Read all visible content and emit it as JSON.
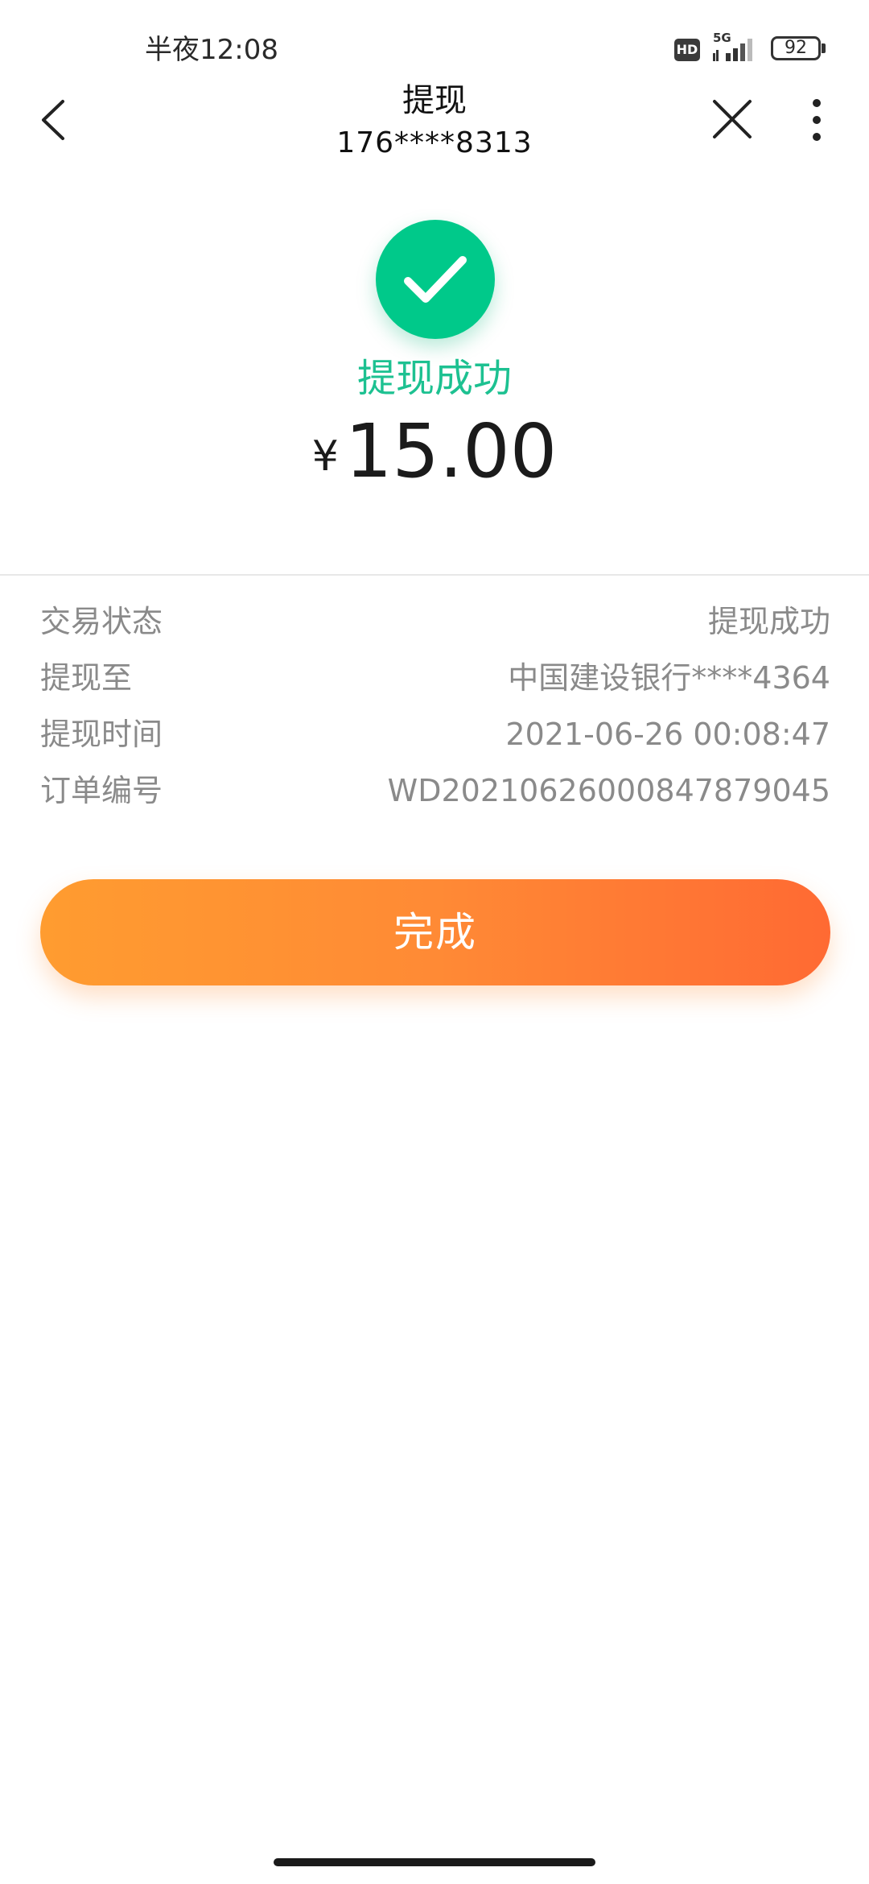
{
  "status_bar": {
    "time": "半夜12:08",
    "hd": "HD",
    "network": "5G",
    "battery": "92"
  },
  "header": {
    "title": "提现",
    "subtitle": "176****8313",
    "icons": [
      "chevron-left-icon",
      "close-icon",
      "more-vertical-icon"
    ]
  },
  "result": {
    "status_text": "提现成功",
    "currency": "¥",
    "amount": "15.00",
    "accent_color": "#1dc191"
  },
  "details": [
    {
      "label": "交易状态",
      "value": "提现成功"
    },
    {
      "label": "提现至",
      "value": "中国建设银行****4364"
    },
    {
      "label": "提现时间",
      "value": "2021-06-26 00:08:47"
    },
    {
      "label": "订单编号",
      "value": "WD20210626000847879045"
    }
  ],
  "done_button": {
    "label": "完成",
    "gradient_start": "#ff9c30",
    "gradient_end": "#ff6a33"
  }
}
